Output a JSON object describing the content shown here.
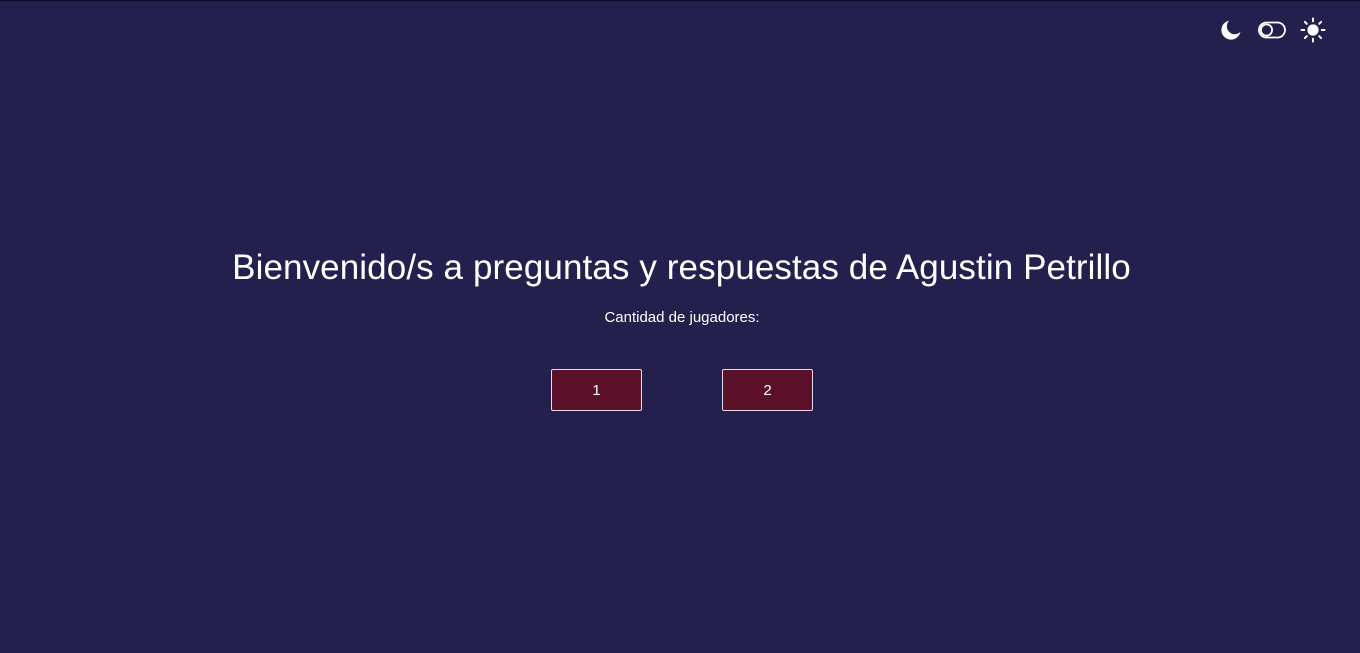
{
  "theme_controls": {
    "dark_icon": "moon-icon",
    "toggle_icon": "toggle-off-icon",
    "light_icon": "sun-icon"
  },
  "main": {
    "title": "Bienvenido/s a preguntas y respuestas de Agustin Petrillo",
    "players_label": "Cantidad de jugadores:",
    "player_options": [
      {
        "label": "1"
      },
      {
        "label": "2"
      }
    ]
  },
  "colors": {
    "background": "#24204e",
    "button_background": "#5c1029",
    "button_border": "#e6dce6",
    "text": "#ffffff"
  }
}
